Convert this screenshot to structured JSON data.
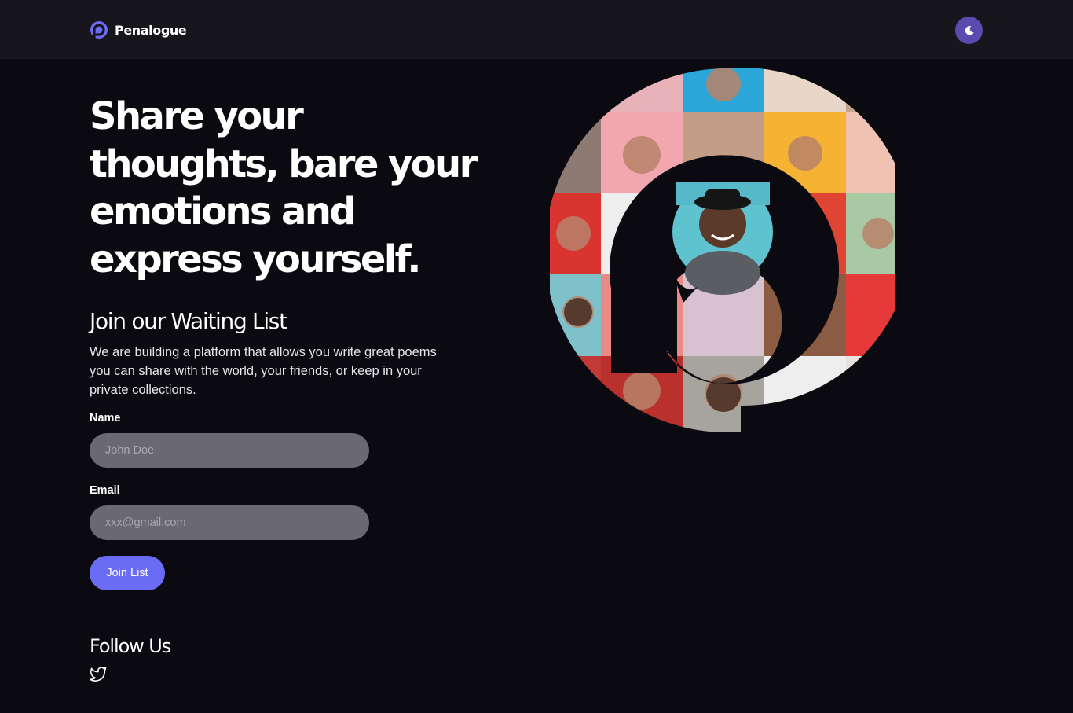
{
  "header": {
    "brand_name": "Penalogue",
    "logo_icon": "penalogue-logo-icon",
    "theme_toggle_icon": "moon-icon"
  },
  "hero": {
    "headline": "Share your thoughts, bare your emotions and express yourself.",
    "image_icon": "speech-bubble-portrait-collage"
  },
  "waitlist": {
    "title": "Join our Waiting List",
    "description": "We are building a platform that allows you write great poems you can share with the world, your friends, or keep in your private collections.",
    "name_label": "Name",
    "name_value": "",
    "name_placeholder": "John Doe",
    "email_label": "Email",
    "email_value": "",
    "email_placeholder": "xxx@gmail.com",
    "submit_label": "Join List"
  },
  "follow": {
    "title": "Follow Us",
    "social_icon": "twitter-icon"
  },
  "colors": {
    "page_background": "#0b0a10",
    "header_background": "#17161c",
    "accent": "#6b6cf5",
    "theme_toggle": "#5b4bb0",
    "input_background": "#6a696f"
  }
}
